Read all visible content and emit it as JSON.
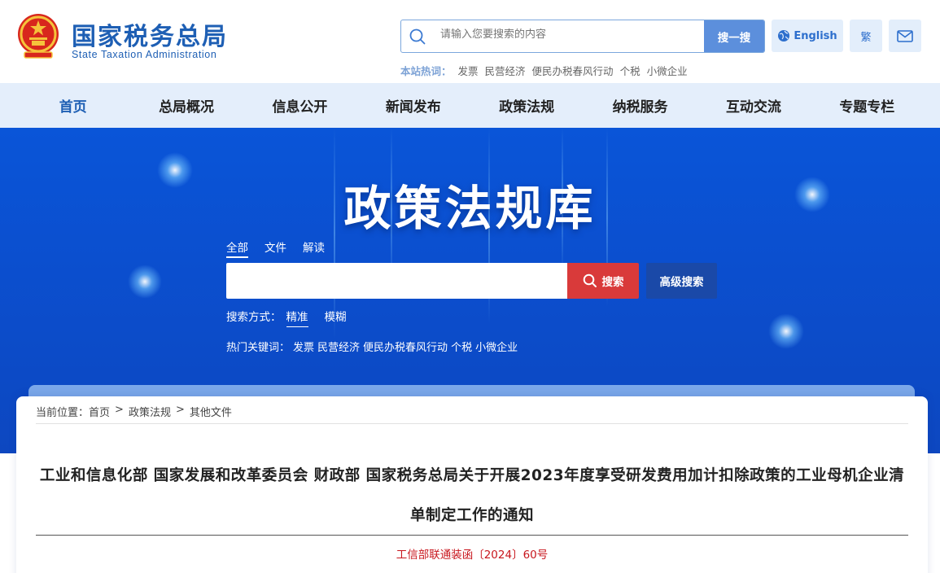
{
  "header": {
    "title_cn": "国家税务总局",
    "title_en": "State Taxation Administration",
    "search_placeholder": "请输入您要搜索的内容",
    "search_button": "搜一搜",
    "english_button": "English",
    "traditional_button": "繁",
    "hotwords_label": "本站热词：",
    "hotwords": [
      "发票",
      "民营经济",
      "便民办税春风行动",
      "个税",
      "小微企业"
    ]
  },
  "nav": [
    "首页",
    "总局概况",
    "信息公开",
    "新闻发布",
    "政策法规",
    "纳税服务",
    "互动交流",
    "专题专栏"
  ],
  "banner": {
    "title": "政策法规库",
    "tabs": [
      "全部",
      "文件",
      "解读"
    ],
    "search_button": "搜索",
    "advanced_button": "高级搜索",
    "mode_label": "搜索方式：",
    "modes": [
      "精准",
      "模糊"
    ],
    "hot_label": "热门关键词：",
    "hot_words": [
      "发票",
      "民营经济",
      "便民办税春风行动",
      "个税",
      "小微企业"
    ]
  },
  "content": {
    "breadcrumb_label": "当前位置：",
    "breadcrumb": [
      "首页",
      "政策法规",
      "其他文件"
    ],
    "breadcrumb_sep": ">",
    "title_line1": "工业和信息化部 国家发展和改革委员会 财政部 国家税务总局关于开展2023年度享受研发费用加计扣除政策的工业母机企业清",
    "title_line2": "单制定工作的通知",
    "doc_number": "工信部联通装函〔2024〕60号"
  },
  "colors": {
    "brand_blue": "#1e5fb4",
    "nav_bg": "#e4eefb",
    "banner_blue": "#0b4fcf",
    "search_red": "#d93a3a",
    "doc_number_red": "#c8161d"
  }
}
